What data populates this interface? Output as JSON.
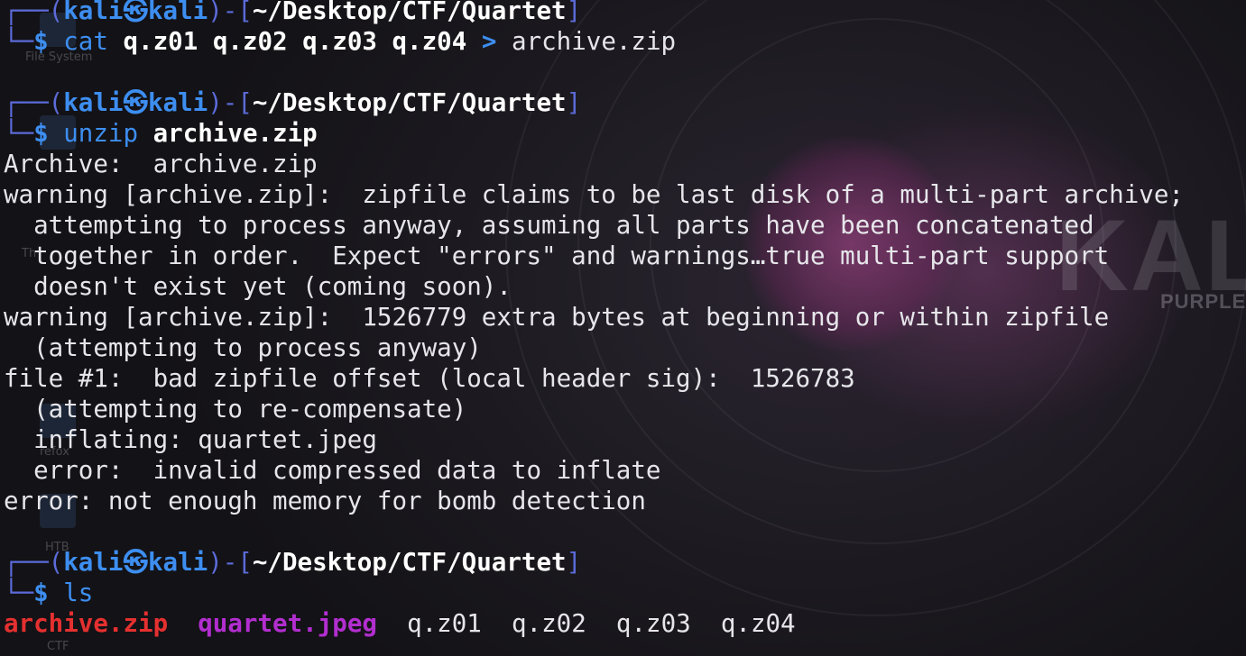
{
  "prompt": {
    "user": "kali",
    "skull": "㉿",
    "host": "kali",
    "path": "~/Desktop/CTF/Quartet"
  },
  "commands": [
    {
      "cmd": "cat",
      "args": "q.z01 q.z02 q.z03 q.z04",
      "operator": ">",
      "target": "archive.zip"
    },
    {
      "cmd": "unzip",
      "args": "archive.zip"
    },
    {
      "cmd": "ls",
      "args": ""
    }
  ],
  "output": [
    "Archive:  archive.zip",
    "warning [archive.zip]:  zipfile claims to be last disk of a multi-part archive;",
    "  attempting to process anyway, assuming all parts have been concatenated",
    "  together in order.  Expect \"errors\" and warnings…true multi-part support",
    "  doesn't exist yet (coming soon).",
    "warning [archive.zip]:  1526779 extra bytes at beginning or within zipfile",
    "  (attempting to process anyway)",
    "file #1:  bad zipfile offset (local header sig):  1526783",
    "  (attempting to re-compensate)",
    "  inflating: quartet.jpeg",
    "  error:  invalid compressed data to inflate",
    "error: not enough memory for bomb detection"
  ],
  "ls_output": [
    {
      "name": "archive.zip",
      "kind": "archive"
    },
    {
      "name": "quartet.jpeg",
      "kind": "image"
    },
    {
      "name": "q.z01",
      "kind": "plain"
    },
    {
      "name": "q.z02",
      "kind": "plain"
    },
    {
      "name": "q.z03",
      "kind": "plain"
    },
    {
      "name": "q.z04",
      "kind": "plain"
    }
  ],
  "desktop": {
    "icon_labels": [
      "File System",
      "Th",
      "refox",
      "HTB",
      "CTF"
    ],
    "wallpaper_wordmark": "KALI",
    "wallpaper_subword": "PURPLE"
  },
  "colors": {
    "prompt_frame": "#5b6bd9",
    "prompt_user": "#3d8ef0",
    "archive_file": "#e53030",
    "image_file": "#b22ecf",
    "text": "#e6e6ea"
  }
}
